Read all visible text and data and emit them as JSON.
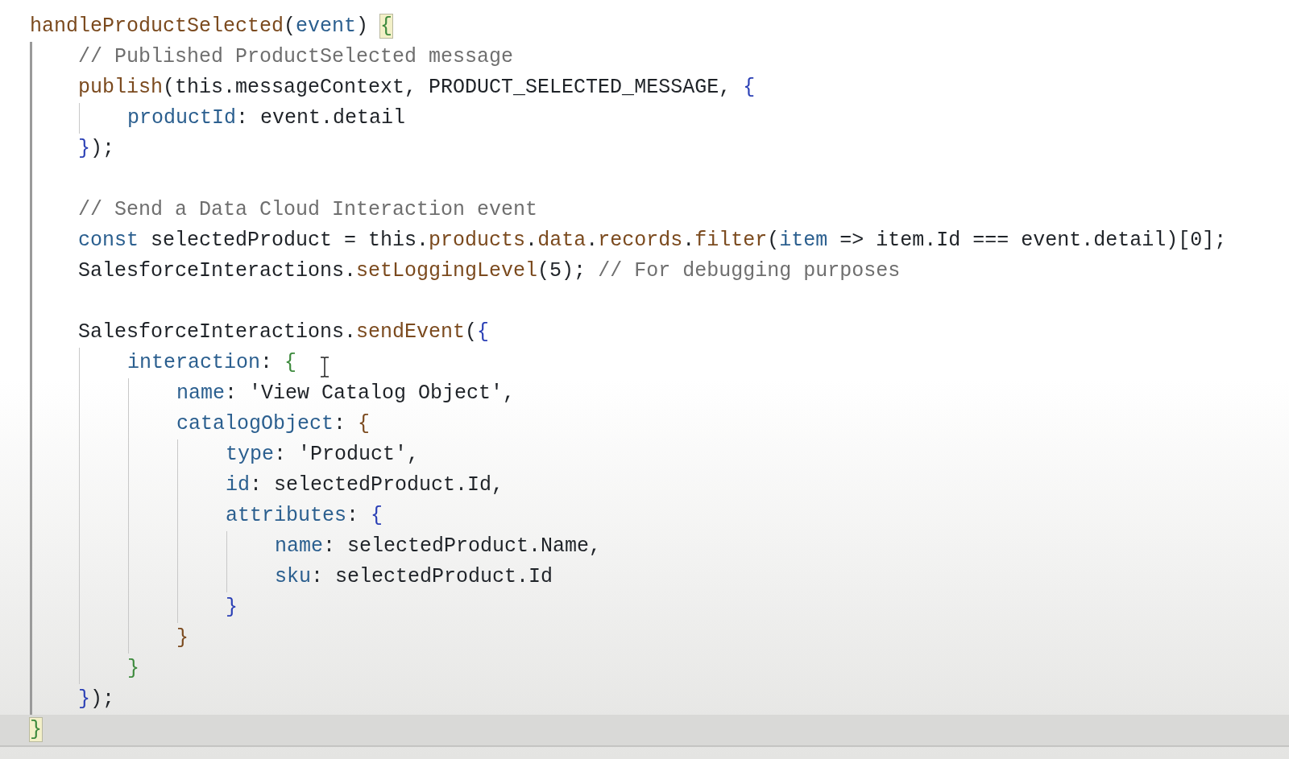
{
  "editor": {
    "root": {
      "kind": "block",
      "close_line_current": true,
      "open": [
        {
          "kind": "fn",
          "text": "handleProductSelected"
        },
        {
          "kind": "plain",
          "text": "("
        },
        {
          "kind": "param",
          "text": "event"
        },
        {
          "kind": "plain",
          "text": ") "
        },
        {
          "kind": "matched_bracket",
          "text": "{"
        }
      ],
      "close": [
        {
          "kind": "matched_bracket",
          "text": "}"
        }
      ],
      "children": [
        {
          "kind": "line",
          "tokens": [
            {
              "kind": "comment",
              "text": "// Published ProductSelected message"
            }
          ]
        },
        {
          "kind": "block",
          "close_line_current": false,
          "open": [
            {
              "kind": "fn",
              "text": "publish"
            },
            {
              "kind": "plain",
              "text": "(this.messageContext, PRODUCT_SELECTED_MESSAGE, "
            },
            {
              "kind": "bracket_a",
              "text": "{"
            }
          ],
          "children": [
            {
              "kind": "line",
              "tokens": [
                {
                  "kind": "param",
                  "text": "productId"
                },
                {
                  "kind": "plain",
                  "text": ": event.detail"
                }
              ]
            }
          ],
          "close": [
            {
              "kind": "bracket_a",
              "text": "}"
            },
            {
              "kind": "plain",
              "text": ");"
            }
          ]
        },
        {
          "kind": "blank"
        },
        {
          "kind": "line",
          "tokens": [
            {
              "kind": "comment",
              "text": "// Send a Data Cloud Interaction event"
            }
          ]
        },
        {
          "kind": "line",
          "tokens": [
            {
              "kind": "keyword",
              "text": "const"
            },
            {
              "kind": "plain",
              "text": " selectedProduct = this."
            },
            {
              "kind": "fn",
              "text": "products"
            },
            {
              "kind": "plain",
              "text": "."
            },
            {
              "kind": "fn",
              "text": "data"
            },
            {
              "kind": "plain",
              "text": "."
            },
            {
              "kind": "fn",
              "text": "records"
            },
            {
              "kind": "plain",
              "text": "."
            },
            {
              "kind": "fn",
              "text": "filter"
            },
            {
              "kind": "plain",
              "text": "("
            },
            {
              "kind": "param",
              "text": "item"
            },
            {
              "kind": "plain",
              "text": " => item.Id === event.detail)[0];"
            }
          ]
        },
        {
          "kind": "line",
          "tokens": [
            {
              "kind": "plain",
              "text": "SalesforceInteractions."
            },
            {
              "kind": "fn",
              "text": "setLoggingLevel"
            },
            {
              "kind": "plain",
              "text": "(5); "
            },
            {
              "kind": "comment",
              "text": "// For debugging purposes"
            }
          ]
        },
        {
          "kind": "blank"
        },
        {
          "kind": "block",
          "close_line_current": false,
          "open": [
            {
              "kind": "plain",
              "text": "SalesforceInteractions."
            },
            {
              "kind": "fn",
              "text": "sendEvent"
            },
            {
              "kind": "plain",
              "text": "("
            },
            {
              "kind": "bracket_a",
              "text": "{"
            }
          ],
          "children": [
            {
              "kind": "block",
              "close_line_current": false,
              "open": [
                {
                  "kind": "param",
                  "text": "interaction"
                },
                {
                  "kind": "plain",
                  "text": ": "
                },
                {
                  "kind": "bracket_b",
                  "text": "{"
                }
              ],
              "children": [
                {
                  "kind": "line",
                  "tokens": [
                    {
                      "kind": "param",
                      "text": "name"
                    },
                    {
                      "kind": "plain",
                      "text": ": 'View Catalog Object',"
                    }
                  ]
                },
                {
                  "kind": "block",
                  "close_line_current": false,
                  "open": [
                    {
                      "kind": "param",
                      "text": "catalogObject"
                    },
                    {
                      "kind": "plain",
                      "text": ": "
                    },
                    {
                      "kind": "bracket_c",
                      "text": "{"
                    }
                  ],
                  "children": [
                    {
                      "kind": "line",
                      "tokens": [
                        {
                          "kind": "param",
                          "text": "type"
                        },
                        {
                          "kind": "plain",
                          "text": ": 'Product',"
                        }
                      ]
                    },
                    {
                      "kind": "line",
                      "tokens": [
                        {
                          "kind": "param",
                          "text": "id"
                        },
                        {
                          "kind": "plain",
                          "text": ": selectedProduct.Id,"
                        }
                      ]
                    },
                    {
                      "kind": "block",
                      "close_line_current": false,
                      "open": [
                        {
                          "kind": "param",
                          "text": "attributes"
                        },
                        {
                          "kind": "plain",
                          "text": ": "
                        },
                        {
                          "kind": "bracket_a",
                          "text": "{"
                        }
                      ],
                      "children": [
                        {
                          "kind": "line",
                          "tokens": [
                            {
                              "kind": "param",
                              "text": "name"
                            },
                            {
                              "kind": "plain",
                              "text": ": selectedProduct.Name,"
                            }
                          ]
                        },
                        {
                          "kind": "line",
                          "tokens": [
                            {
                              "kind": "param",
                              "text": "sku"
                            },
                            {
                              "kind": "plain",
                              "text": ": selectedProduct.Id"
                            }
                          ]
                        }
                      ],
                      "close": [
                        {
                          "kind": "bracket_a",
                          "text": "}"
                        }
                      ]
                    }
                  ],
                  "close": [
                    {
                      "kind": "bracket_c",
                      "text": "}"
                    }
                  ]
                }
              ],
              "close": [
                {
                  "kind": "bracket_b",
                  "text": "}"
                }
              ]
            }
          ],
          "close": [
            {
              "kind": "bracket_a",
              "text": "}"
            },
            {
              "kind": "plain",
              "text": ");"
            }
          ]
        }
      ]
    }
  }
}
